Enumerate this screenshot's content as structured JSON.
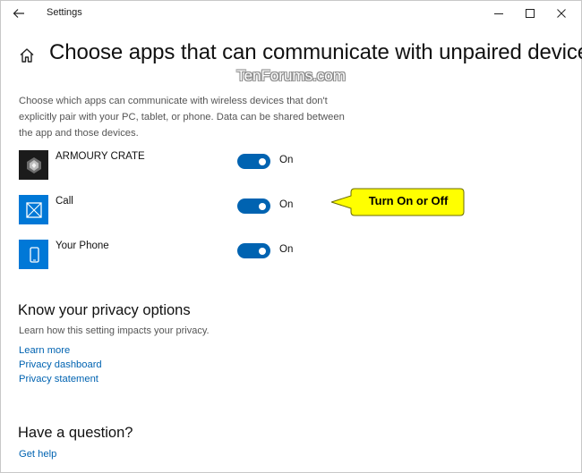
{
  "window": {
    "title": "Settings",
    "back_icon": "back-arrow-icon",
    "controls": [
      "minimize-icon",
      "maximize-icon",
      "close-icon"
    ]
  },
  "header": {
    "home_icon": "home-icon",
    "title": "Choose apps that can communicate with unpaired devices"
  },
  "watermark": "TenForums.com",
  "description": "Choose which apps can communicate with wireless devices that don't explicitly pair with your PC, tablet, or phone. Data can be shared between the app and those devices.",
  "apps": [
    {
      "name": "ARMOURY CRATE",
      "state": "On",
      "on": true,
      "icon": "armoury-crate-icon",
      "icon_bg": "#1b1b1b"
    },
    {
      "name": "Call",
      "state": "On",
      "on": true,
      "icon": "call-app-icon",
      "icon_bg": "#0078d7"
    },
    {
      "name": "Your Phone",
      "state": "On",
      "on": true,
      "icon": "your-phone-icon",
      "icon_bg": "#0078d7"
    }
  ],
  "callout": {
    "text": "Turn On or Off",
    "bg": "#ffff00"
  },
  "privacy": {
    "title": "Know your privacy options",
    "description": "Learn how this setting impacts your privacy.",
    "links": [
      "Learn more",
      "Privacy dashboard",
      "Privacy statement"
    ]
  },
  "question": {
    "title": "Have a question?",
    "link": "Get help"
  },
  "colors": {
    "accent": "#0063b1",
    "link": "#0063b1",
    "callout": "#ffff00"
  }
}
